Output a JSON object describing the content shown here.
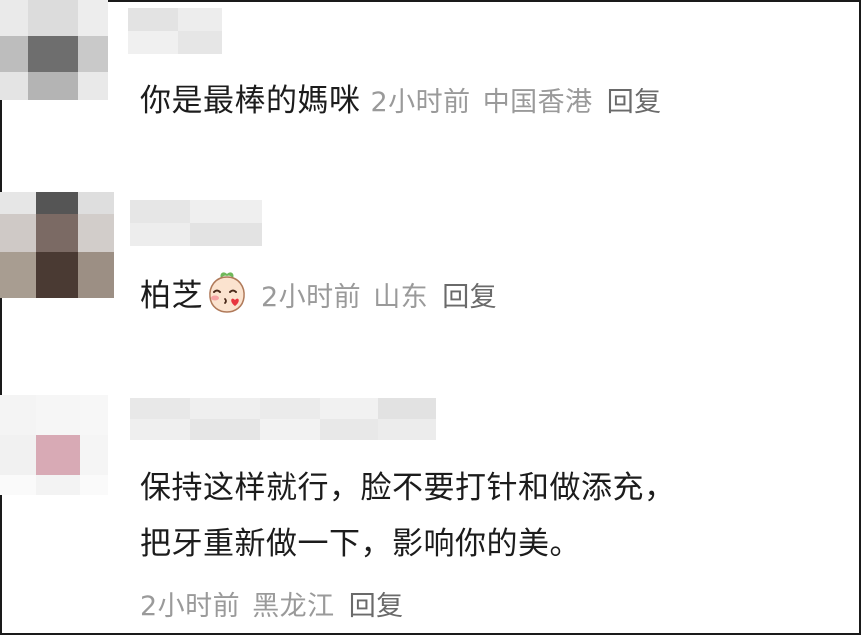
{
  "comments": [
    {
      "text": "你是最棒的媽咪",
      "time": "2小时前",
      "location": "中国香港",
      "reply": "回复"
    },
    {
      "text": "柏芝",
      "emoji": "blushing-peach-emoji",
      "time": "2小时前",
      "location": "山东",
      "reply": "回复"
    },
    {
      "text_line1": "保持这样就行，脸不要打针和做添充，",
      "text_line2": "把牙重新做一下，影响你的美。",
      "time": "2小时前",
      "location": "黑龙江",
      "reply": "回复"
    }
  ],
  "colors": {
    "text": "#1c1c1c",
    "meta": "#9a9a9a",
    "reply": "#6a6a6a",
    "border": "#1a1a1a"
  }
}
